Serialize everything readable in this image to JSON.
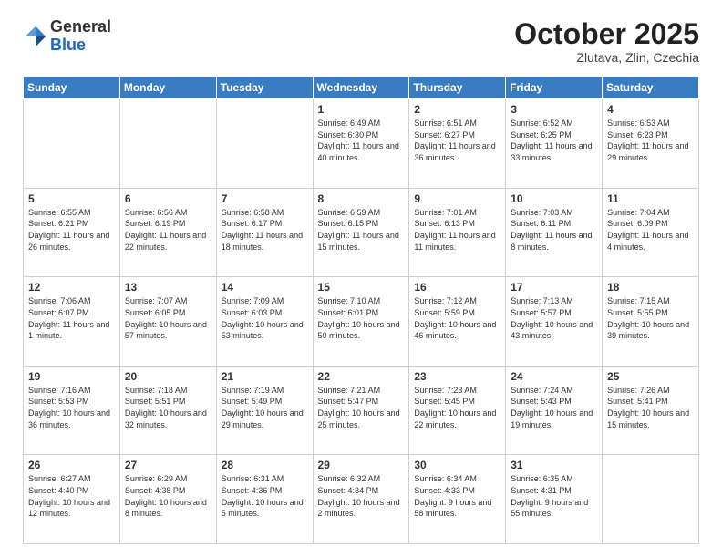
{
  "logo": {
    "general": "General",
    "blue": "Blue"
  },
  "header": {
    "title": "October 2025",
    "subtitle": "Zlutava, Zlin, Czechia"
  },
  "days_of_week": [
    "Sunday",
    "Monday",
    "Tuesday",
    "Wednesday",
    "Thursday",
    "Friday",
    "Saturday"
  ],
  "weeks": [
    [
      {
        "day": "",
        "info": ""
      },
      {
        "day": "",
        "info": ""
      },
      {
        "day": "",
        "info": ""
      },
      {
        "day": "1",
        "info": "Sunrise: 6:49 AM\nSunset: 6:30 PM\nDaylight: 11 hours\nand 40 minutes."
      },
      {
        "day": "2",
        "info": "Sunrise: 6:51 AM\nSunset: 6:27 PM\nDaylight: 11 hours\nand 36 minutes."
      },
      {
        "day": "3",
        "info": "Sunrise: 6:52 AM\nSunset: 6:25 PM\nDaylight: 11 hours\nand 33 minutes."
      },
      {
        "day": "4",
        "info": "Sunrise: 6:53 AM\nSunset: 6:23 PM\nDaylight: 11 hours\nand 29 minutes."
      }
    ],
    [
      {
        "day": "5",
        "info": "Sunrise: 6:55 AM\nSunset: 6:21 PM\nDaylight: 11 hours\nand 26 minutes."
      },
      {
        "day": "6",
        "info": "Sunrise: 6:56 AM\nSunset: 6:19 PM\nDaylight: 11 hours\nand 22 minutes."
      },
      {
        "day": "7",
        "info": "Sunrise: 6:58 AM\nSunset: 6:17 PM\nDaylight: 11 hours\nand 18 minutes."
      },
      {
        "day": "8",
        "info": "Sunrise: 6:59 AM\nSunset: 6:15 PM\nDaylight: 11 hours\nand 15 minutes."
      },
      {
        "day": "9",
        "info": "Sunrise: 7:01 AM\nSunset: 6:13 PM\nDaylight: 11 hours\nand 11 minutes."
      },
      {
        "day": "10",
        "info": "Sunrise: 7:03 AM\nSunset: 6:11 PM\nDaylight: 11 hours\nand 8 minutes."
      },
      {
        "day": "11",
        "info": "Sunrise: 7:04 AM\nSunset: 6:09 PM\nDaylight: 11 hours\nand 4 minutes."
      }
    ],
    [
      {
        "day": "12",
        "info": "Sunrise: 7:06 AM\nSunset: 6:07 PM\nDaylight: 11 hours\nand 1 minute."
      },
      {
        "day": "13",
        "info": "Sunrise: 7:07 AM\nSunset: 6:05 PM\nDaylight: 10 hours\nand 57 minutes."
      },
      {
        "day": "14",
        "info": "Sunrise: 7:09 AM\nSunset: 6:03 PM\nDaylight: 10 hours\nand 53 minutes."
      },
      {
        "day": "15",
        "info": "Sunrise: 7:10 AM\nSunset: 6:01 PM\nDaylight: 10 hours\nand 50 minutes."
      },
      {
        "day": "16",
        "info": "Sunrise: 7:12 AM\nSunset: 5:59 PM\nDaylight: 10 hours\nand 46 minutes."
      },
      {
        "day": "17",
        "info": "Sunrise: 7:13 AM\nSunset: 5:57 PM\nDaylight: 10 hours\nand 43 minutes."
      },
      {
        "day": "18",
        "info": "Sunrise: 7:15 AM\nSunset: 5:55 PM\nDaylight: 10 hours\nand 39 minutes."
      }
    ],
    [
      {
        "day": "19",
        "info": "Sunrise: 7:16 AM\nSunset: 5:53 PM\nDaylight: 10 hours\nand 36 minutes."
      },
      {
        "day": "20",
        "info": "Sunrise: 7:18 AM\nSunset: 5:51 PM\nDaylight: 10 hours\nand 32 minutes."
      },
      {
        "day": "21",
        "info": "Sunrise: 7:19 AM\nSunset: 5:49 PM\nDaylight: 10 hours\nand 29 minutes."
      },
      {
        "day": "22",
        "info": "Sunrise: 7:21 AM\nSunset: 5:47 PM\nDaylight: 10 hours\nand 25 minutes."
      },
      {
        "day": "23",
        "info": "Sunrise: 7:23 AM\nSunset: 5:45 PM\nDaylight: 10 hours\nand 22 minutes."
      },
      {
        "day": "24",
        "info": "Sunrise: 7:24 AM\nSunset: 5:43 PM\nDaylight: 10 hours\nand 19 minutes."
      },
      {
        "day": "25",
        "info": "Sunrise: 7:26 AM\nSunset: 5:41 PM\nDaylight: 10 hours\nand 15 minutes."
      }
    ],
    [
      {
        "day": "26",
        "info": "Sunrise: 6:27 AM\nSunset: 4:40 PM\nDaylight: 10 hours\nand 12 minutes."
      },
      {
        "day": "27",
        "info": "Sunrise: 6:29 AM\nSunset: 4:38 PM\nDaylight: 10 hours\nand 8 minutes."
      },
      {
        "day": "28",
        "info": "Sunrise: 6:31 AM\nSunset: 4:36 PM\nDaylight: 10 hours\nand 5 minutes."
      },
      {
        "day": "29",
        "info": "Sunrise: 6:32 AM\nSunset: 4:34 PM\nDaylight: 10 hours\nand 2 minutes."
      },
      {
        "day": "30",
        "info": "Sunrise: 6:34 AM\nSunset: 4:33 PM\nDaylight: 9 hours\nand 58 minutes."
      },
      {
        "day": "31",
        "info": "Sunrise: 6:35 AM\nSunset: 4:31 PM\nDaylight: 9 hours\nand 55 minutes."
      },
      {
        "day": "",
        "info": ""
      }
    ]
  ]
}
